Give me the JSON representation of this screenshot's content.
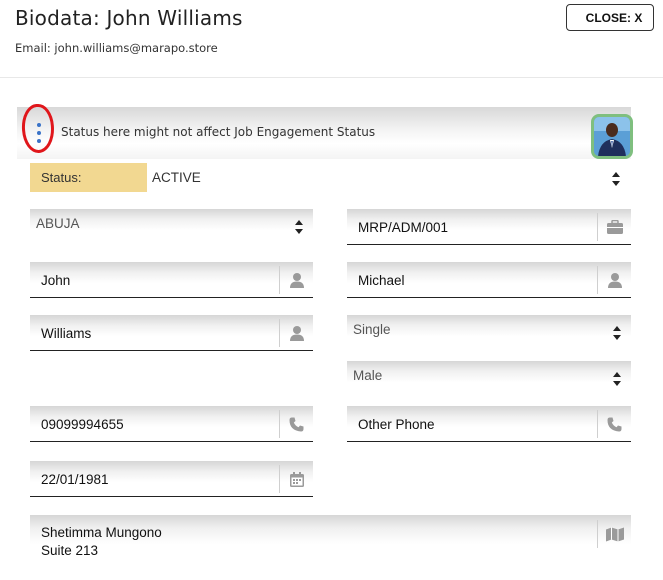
{
  "header": {
    "title": "Biodata: John Williams",
    "email": "Email: john.williams@marapo.store",
    "close_label": "CLOSE: X"
  },
  "banner": {
    "text": "Status here might not affect Job Engagement Status",
    "menu_icon": "vertical-dots-icon",
    "annotation_color": "#e0161b",
    "avatar_border_color": "#7fbf7f"
  },
  "status": {
    "label": "Status:",
    "value": "ACTIVE",
    "label_bg": "#f2d891"
  },
  "fields": {
    "location": "ABUJA",
    "staff_id": "MRP/ADM/001",
    "first_name": "John",
    "middle_name": "Michael",
    "last_name": "Williams",
    "marital_status": "Single",
    "gender": "Male",
    "phone": "09099994655",
    "other_phone": "Other Phone",
    "dob": "22/01/1981",
    "address_line1": "Shetimma Mungono",
    "address_line2": "Suite 213"
  },
  "icons": {
    "briefcase": "briefcase-icon",
    "user": "user-icon",
    "phone": "phone-icon",
    "calendar": "calendar-icon",
    "map": "map-icon",
    "select_arrows": "sort-arrows-icon"
  }
}
